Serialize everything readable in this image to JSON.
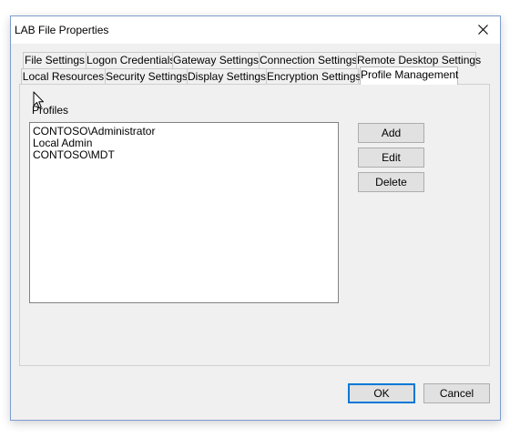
{
  "window": {
    "title": "LAB File Properties"
  },
  "tabs": {
    "row1": [
      "File Settings",
      "Logon Credentials",
      "Gateway Settings",
      "Connection Settings",
      "Remote Desktop Settings"
    ],
    "row2": [
      "Local Resources",
      "Security Settings",
      "Display Settings",
      "Encryption Settings",
      "Profile Management"
    ],
    "active": "Profile Management"
  },
  "profiles": {
    "label": "Profiles",
    "items": [
      "CONTOSO\\Administrator",
      "Local Admin",
      "CONTOSO\\MDT"
    ]
  },
  "buttons": {
    "add": "Add",
    "edit": "Edit",
    "delete": "Delete",
    "ok": "OK",
    "cancel": "Cancel"
  },
  "icons": {
    "close": "close-icon",
    "cursor": "mouse-pointer-icon"
  }
}
